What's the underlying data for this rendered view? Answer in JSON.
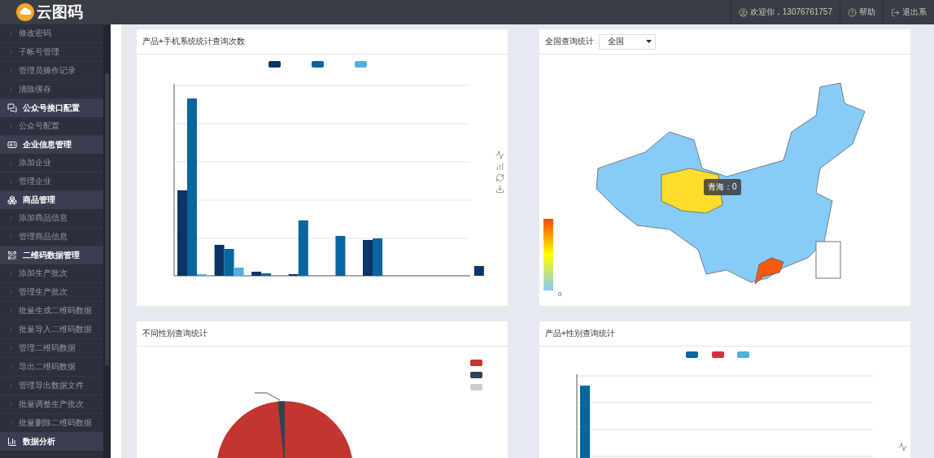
{
  "header": {
    "logo": "云图码",
    "links": [
      {
        "kind": "user",
        "label": "欢迎你，13076761757"
      },
      {
        "kind": "help",
        "label": "帮助"
      },
      {
        "kind": "logout",
        "label": "退出系"
      }
    ]
  },
  "sidebar": {
    "items": [
      {
        "kind": "link",
        "label": "修改密码"
      },
      {
        "kind": "link",
        "label": "子帐号管理"
      },
      {
        "kind": "link",
        "label": "管理员操作记录"
      },
      {
        "kind": "link",
        "label": "清除缓存"
      },
      {
        "kind": "group",
        "label": "公众号接口配置",
        "children": [
          {
            "label": "公众号配置"
          }
        ]
      },
      {
        "kind": "group",
        "label": "企业信息管理",
        "children": [
          {
            "label": "添加企业"
          },
          {
            "label": "管理企业"
          }
        ]
      },
      {
        "kind": "group",
        "label": "商品管理",
        "children": [
          {
            "label": "添加商品信息"
          },
          {
            "label": "管理商品信息"
          }
        ]
      },
      {
        "kind": "group",
        "label": "二维码数据管理",
        "children": [
          {
            "label": "添加生产批次"
          },
          {
            "label": "管理生产批次"
          },
          {
            "label": "批量生成二维码数据"
          },
          {
            "label": "批量导入二维码数据"
          },
          {
            "label": "管理二维码数据"
          },
          {
            "label": "导出二维码数据"
          },
          {
            "label": "管理导出数据文件"
          },
          {
            "label": "批量调整生产批次"
          },
          {
            "label": "批量删除二维码数据"
          }
        ]
      },
      {
        "kind": "group",
        "label": "数据分析"
      }
    ]
  },
  "panels": [
    {
      "kind": "bars",
      "title": "产品+手机系统统计查询次数"
    },
    {
      "kind": "map",
      "title": "全国查询统计",
      "select": "全国",
      "tooltip": "青海：0",
      "scale_min": "0"
    },
    {
      "kind": "pie",
      "title": "不同性别查询统计"
    },
    {
      "kind": "bars2",
      "title": "产品+性别查询统计"
    }
  ]
}
